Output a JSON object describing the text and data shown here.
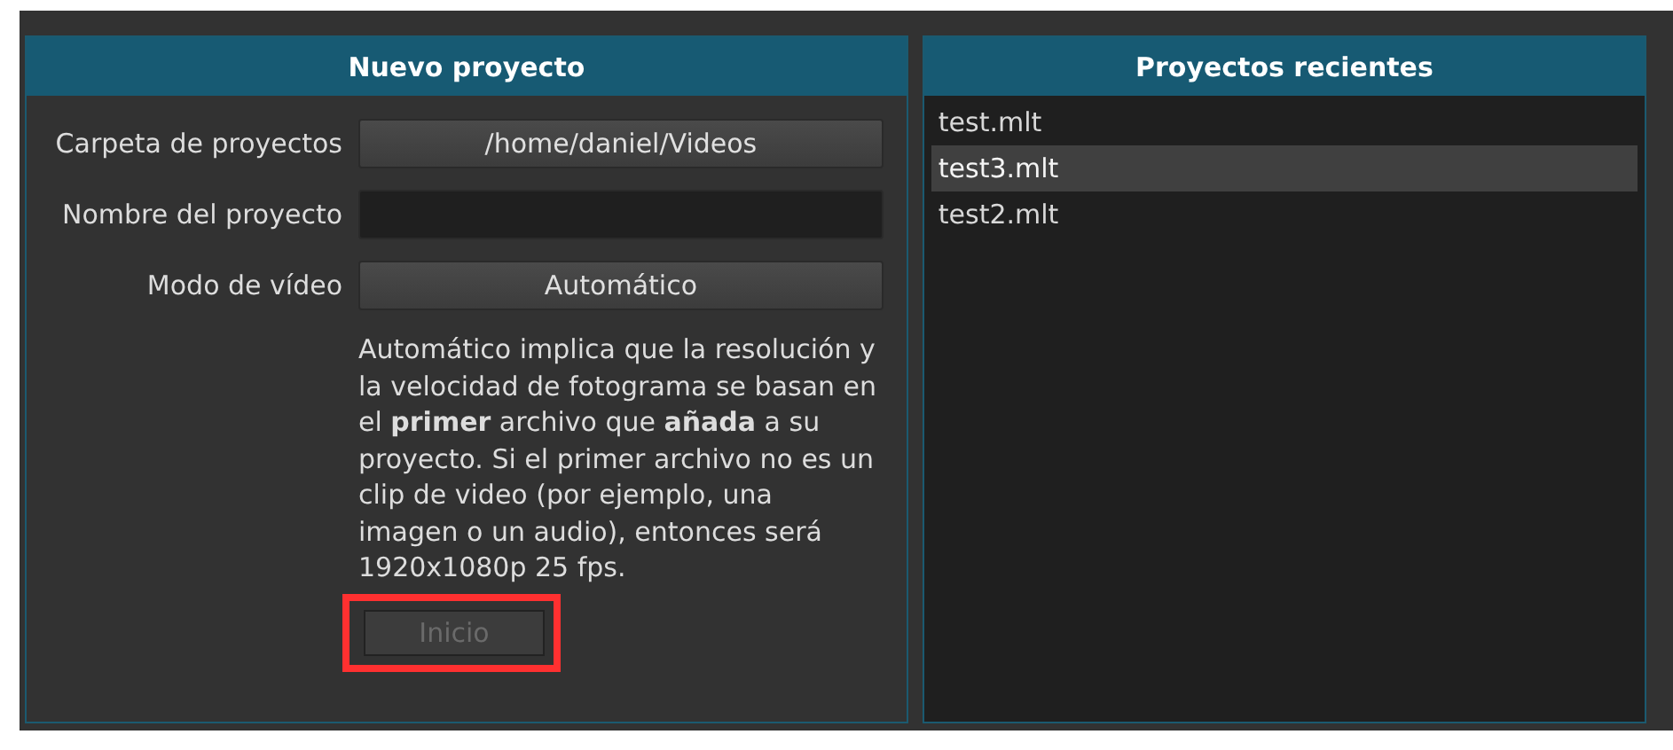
{
  "new_project": {
    "title": "Nuevo proyecto",
    "fields": [
      {
        "kind": "button",
        "label": "Carpeta de proyectos",
        "value": "/home/daniel/Videos"
      },
      {
        "kind": "input",
        "label": "Nombre del proyecto"
      },
      {
        "kind": "button",
        "label": "Modo de vídeo",
        "value": "Automático"
      }
    ],
    "description": "Automático implica que la resolución y la velocidad de fotograma se basan en el **primer** archivo que **añada** a su proyecto. Si el primer archivo no es un clip de video (por ejemplo, una imagen o un audio), entonces será 1920x1080p 25 fps.",
    "start_button": {
      "label": "Inicio",
      "disabled": true,
      "highlighted": true
    }
  },
  "recent_projects": {
    "title": "Proyectos recientes",
    "items": [
      {
        "label": "test.mlt",
        "selected": false
      },
      {
        "label": "test3.mlt",
        "selected": true
      },
      {
        "label": "test2.mlt",
        "selected": false
      }
    ]
  }
}
